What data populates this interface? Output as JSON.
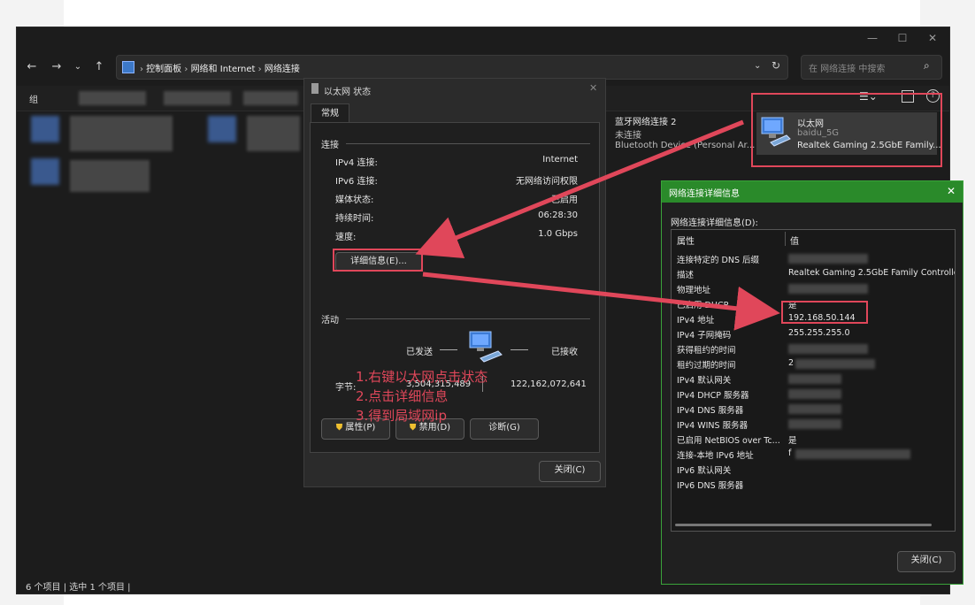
{
  "explorer": {
    "breadcrumb": [
      "控制面板",
      "网络和 Internet",
      "网络连接"
    ],
    "search_placeholder": "在 网络连接 中搜索",
    "status_bar": "6 个项目  |  选中 1 个项目  |",
    "toolbar_first_char": "组",
    "items": {
      "bluetooth": {
        "name": "蓝牙网络连接 2",
        "status": "未连接",
        "device": "Bluetooth Device (Personal Ar..."
      },
      "ethernet": {
        "name": "以太网",
        "status": "baidu_5G",
        "device": "Realtek Gaming 2.5GbE Family..."
      }
    }
  },
  "status_dialog": {
    "title": "以太网 状态",
    "tab": "常规",
    "connection_header": "连接",
    "rows": [
      {
        "label": "IPv4 连接:",
        "value": "Internet"
      },
      {
        "label": "IPv6 连接:",
        "value": "无网络访问权限"
      },
      {
        "label": "媒体状态:",
        "value": "已启用"
      },
      {
        "label": "持续时间:",
        "value": "06:28:30"
      },
      {
        "label": "速度:",
        "value": "1.0 Gbps"
      }
    ],
    "details_button": "详细信息(E)...",
    "activity_header": "活动",
    "sent_label": "已发送",
    "received_label": "已接收",
    "bytes_label": "字节:",
    "bytes_sent": "3,504,315,489",
    "bytes_received": "122,162,072,641",
    "properties_button": "属性(P)",
    "disable_button": "禁用(D)",
    "diagnose_button": "诊断(G)",
    "close_button": "关闭(C)"
  },
  "annotations": [
    "1.右键以太网点击状态",
    "2.点击详细信息",
    "3.得到局域网ip"
  ],
  "details_dialog": {
    "title": "网络连接详细信息",
    "list_label": "网络连接详细信息(D):",
    "col_property": "属性",
    "col_value": "值",
    "rows": [
      {
        "k": "连接特定的 DNS 后缀",
        "v": ""
      },
      {
        "k": "描述",
        "v": "Realtek Gaming 2.5GbE Family Controlle"
      },
      {
        "k": "物理地址",
        "v": ""
      },
      {
        "k": "已启用 DHCP",
        "v": "是"
      },
      {
        "k": "IPv4 地址",
        "v": "192.168.50.144"
      },
      {
        "k": "IPv4 子网掩码",
        "v": "255.255.255.0"
      },
      {
        "k": "获得租约的时间",
        "v": ""
      },
      {
        "k": "租约过期的时间",
        "v": "2"
      },
      {
        "k": "IPv4 默认网关",
        "v": ""
      },
      {
        "k": "IPv4 DHCP 服务器",
        "v": ""
      },
      {
        "k": "IPv4 DNS 服务器",
        "v": ""
      },
      {
        "k": "IPv4 WINS 服务器",
        "v": ""
      },
      {
        "k": "已启用 NetBIOS over Tc...",
        "v": "是"
      },
      {
        "k": "连接-本地 IPv6 地址",
        "v": "f"
      },
      {
        "k": "IPv6 默认网关",
        "v": ""
      },
      {
        "k": "IPv6 DNS 服务器",
        "v": ""
      }
    ],
    "close_button": "关闭(C)"
  },
  "colors": {
    "annotation_red": "#e0475a",
    "details_title_green": "#2a8a2a"
  }
}
